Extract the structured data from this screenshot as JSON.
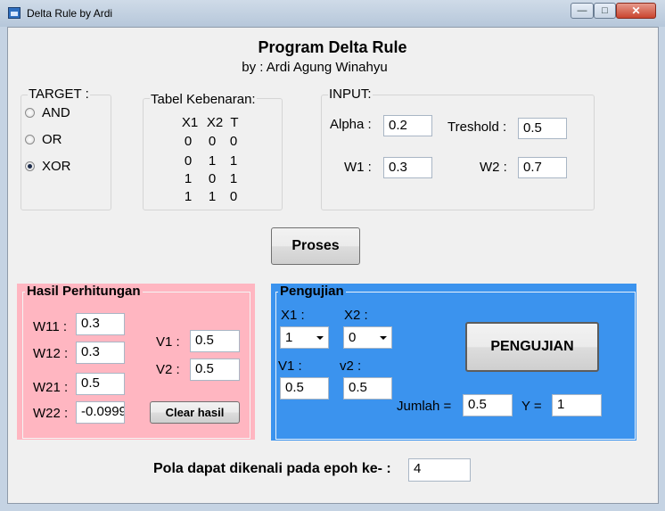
{
  "window": {
    "title": "Delta Rule by Ardi",
    "minimize_glyph": "—",
    "maximize_glyph": "□",
    "close_glyph": "✕"
  },
  "header": {
    "title": "Program Delta Rule",
    "subtitle": "by : Ardi Agung Winahyu"
  },
  "target": {
    "label": "TARGET :",
    "options": [
      "AND",
      "OR",
      "XOR"
    ],
    "selected": "XOR"
  },
  "truth_table": {
    "label": "Tabel Kebenaran:",
    "headers": [
      "X1",
      "X2",
      "T"
    ],
    "rows": [
      [
        "0",
        "0",
        "0"
      ],
      [
        "0",
        "1",
        "1"
      ],
      [
        "1",
        "0",
        "1"
      ],
      [
        "1",
        "1",
        "0"
      ]
    ]
  },
  "input": {
    "label": "INPUT:",
    "alpha_label": "Alpha :",
    "alpha": "0.2",
    "treshold_label": "Treshold :",
    "treshold": "0.5",
    "w1_label": "W1 :",
    "w1": "0.3",
    "w2_label": "W2 :",
    "w2": "0.7"
  },
  "proses_button": "Proses",
  "hasil": {
    "label": "Hasil Perhitungan",
    "w11_label": "W11 :",
    "w11": "0.3",
    "w12_label": "W12 :",
    "w12": "0.3",
    "w21_label": "W21 :",
    "w21": "0.5",
    "w22_label": "W22 :",
    "w22": "-0.0999",
    "v1_label": "V1 :",
    "v1": "0.5",
    "v2_label": "V2 :",
    "v2": "0.5",
    "clear_button": "Clear hasil",
    "panel_color": "#ffb6c1"
  },
  "pengujian": {
    "label": "Pengujian",
    "x1_label": "X1 :",
    "x1": "1",
    "x2_label": "X2 :",
    "x2": "0",
    "v1_label": "V1 :",
    "v1": "0.5",
    "v2_label": "v2 :",
    "v2": "0.5",
    "button": "PENGUJIAN",
    "jumlah_label": "Jumlah =",
    "jumlah": "0.5",
    "y_label": "Y =",
    "y": "1",
    "panel_color": "#3b93ee"
  },
  "epoch": {
    "label": "Pola dapat dikenali pada epoh ke- :",
    "value": "4"
  }
}
